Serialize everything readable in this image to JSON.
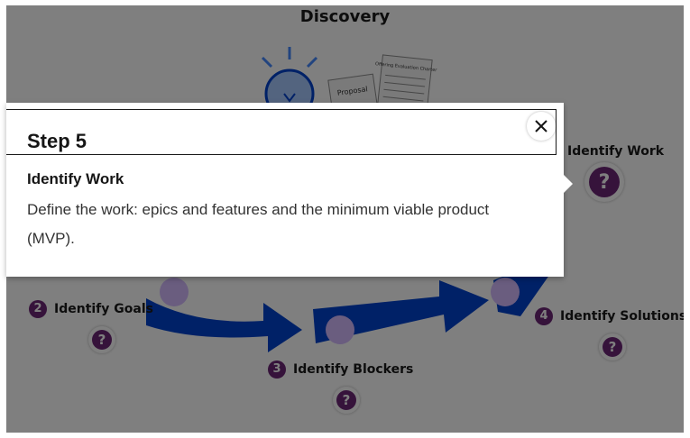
{
  "page": {
    "title": "Discovery"
  },
  "steps": [
    {
      "number": "2",
      "label": "Identify Goals"
    },
    {
      "number": "3",
      "label": "Identify Blockers"
    },
    {
      "number": "4",
      "label": "Identify Solutions"
    },
    {
      "number": "5",
      "label": "Identify Work"
    }
  ],
  "illustration": {
    "proposal_label": "Proposal",
    "charter_label": "Offering Evaluation Charter"
  },
  "help_icon": "?",
  "popover": {
    "step": "Step 5",
    "subtitle": "Identify Work",
    "description": "Define the work: epics and features and the minimum viable product (MVP).",
    "close_icon": "close-icon"
  },
  "colors": {
    "accent_purple": "#6d2777",
    "arrow_blue": "#0043ce",
    "overlay": "rgba(0,0,0,0.5)"
  }
}
